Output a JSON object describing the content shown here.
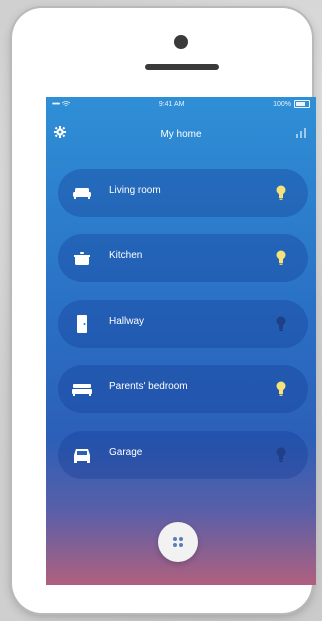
{
  "status_bar": {
    "carrier": "•••••",
    "time": "9:41 AM",
    "battery": "100%"
  },
  "header": {
    "title": "My home",
    "settings_icon": "gear-icon",
    "stats_icon": "bar-chart-icon"
  },
  "rooms": [
    {
      "label": "Living room",
      "icon": "sofa-icon",
      "light_on": true
    },
    {
      "label": "Kitchen",
      "icon": "cooking-pot-icon",
      "light_on": true
    },
    {
      "label": "Hallway",
      "icon": "door-icon",
      "light_on": false
    },
    {
      "label": "Parents' bedroom",
      "icon": "bed-icon",
      "light_on": true
    },
    {
      "label": "Garage",
      "icon": "car-icon",
      "light_on": false
    }
  ],
  "colors": {
    "light_on": "#f6e27a",
    "light_off": "#1f3f86",
    "accent": "#2f8fd6"
  },
  "fab": {
    "icon": "grid-dots-icon"
  }
}
